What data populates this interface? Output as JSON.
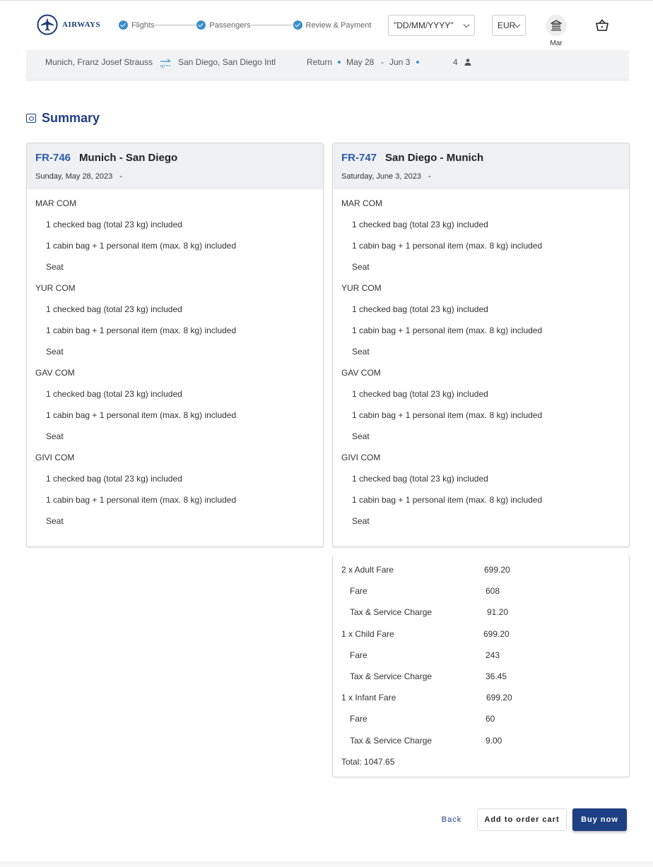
{
  "header": {
    "logo_text": "AIRWAYS",
    "steps": [
      {
        "label": "Flights"
      },
      {
        "label": "Passengers"
      },
      {
        "label": "Review & Payment"
      }
    ],
    "date_format": "\"DD/MM/YYYY\"",
    "currency": "EUR",
    "user_name": "Mar"
  },
  "trip": {
    "origin": "Munich, Franz Josef Strauss",
    "destination": "San Diego, San Diego Intl",
    "type": "Return",
    "depart": "May 28",
    "dash": "-",
    "return": "Jun 3",
    "passengers": "4"
  },
  "summary": {
    "title": "Summary"
  },
  "flights": [
    {
      "number": "FR-746",
      "route": "Munich - San Diego",
      "date": "Sunday, May 28, 2023",
      "dash": "-",
      "passengers": [
        {
          "name": "MAR COM",
          "items": [
            "1 checked bag (total 23 kg) included",
            "1 cabin bag + 1 personal item (max. 8 kg) included",
            "Seat"
          ]
        },
        {
          "name": "YUR COM",
          "items": [
            "1 checked bag (total 23 kg) included",
            "1 cabin bag + 1 personal item (max. 8 kg) included",
            "Seat"
          ]
        },
        {
          "name": "GAV COM",
          "items": [
            "1 checked bag (total 23 kg) included",
            "1 cabin bag + 1 personal item (max. 8 kg) included",
            "Seat"
          ]
        },
        {
          "name": "GIVI COM",
          "items": [
            "1 checked bag (total 23 kg) included",
            "1 cabin bag + 1 personal item (max. 8 kg) included",
            "Seat"
          ]
        }
      ]
    },
    {
      "number": "FR-747",
      "route": "San Diego - Munich",
      "date": "Saturday, June 3, 2023",
      "dash": "-",
      "passengers": [
        {
          "name": "MAR COM",
          "items": [
            "1 checked bag (total 23 kg) included",
            "1 cabin bag + 1 personal item (max. 8 kg) included",
            "Seat"
          ]
        },
        {
          "name": "YUR COM",
          "items": [
            "1 checked bag (total 23 kg) included",
            "1 cabin bag + 1 personal item (max. 8 kg) included",
            "Seat"
          ]
        },
        {
          "name": "GAV COM",
          "items": [
            "1 checked bag (total 23 kg) included",
            "1 cabin bag + 1 personal item (max. 8 kg) included",
            "Seat"
          ]
        },
        {
          "name": "GIVI COM",
          "items": [
            "1 checked bag (total 23 kg) included",
            "1 cabin bag + 1 personal item (max. 8 kg) included",
            "Seat"
          ]
        }
      ]
    }
  ],
  "fare": {
    "adult_label": "2 x Adult Fare",
    "adult_value": "699.20",
    "adult_fare_label": "Fare",
    "adult_fare_value": "608",
    "adult_tax_label": "Tax & Service Charge",
    "adult_tax_value": "91.20",
    "child_label": "1 x Child Fare",
    "child_value": "699.20",
    "child_fare_label": "Fare",
    "child_fare_value": "243",
    "child_tax_label": "Tax & Service Charge",
    "child_tax_value": "36.45",
    "infant_label": "1 x Infant Fare",
    "infant_value": "699.20",
    "infant_fare_label": "Fare",
    "infant_fare_value": "60",
    "infant_tax_label": "Tax & Service Charge",
    "infant_tax_value": "9.00",
    "total": "Total: 1047.65"
  },
  "actions": {
    "back": "Back",
    "add_to_cart": "Add to order cart",
    "buy_now": "Buy now"
  },
  "colors": {
    "primary": "#1f3f85",
    "accent": "#3a8fc7"
  }
}
